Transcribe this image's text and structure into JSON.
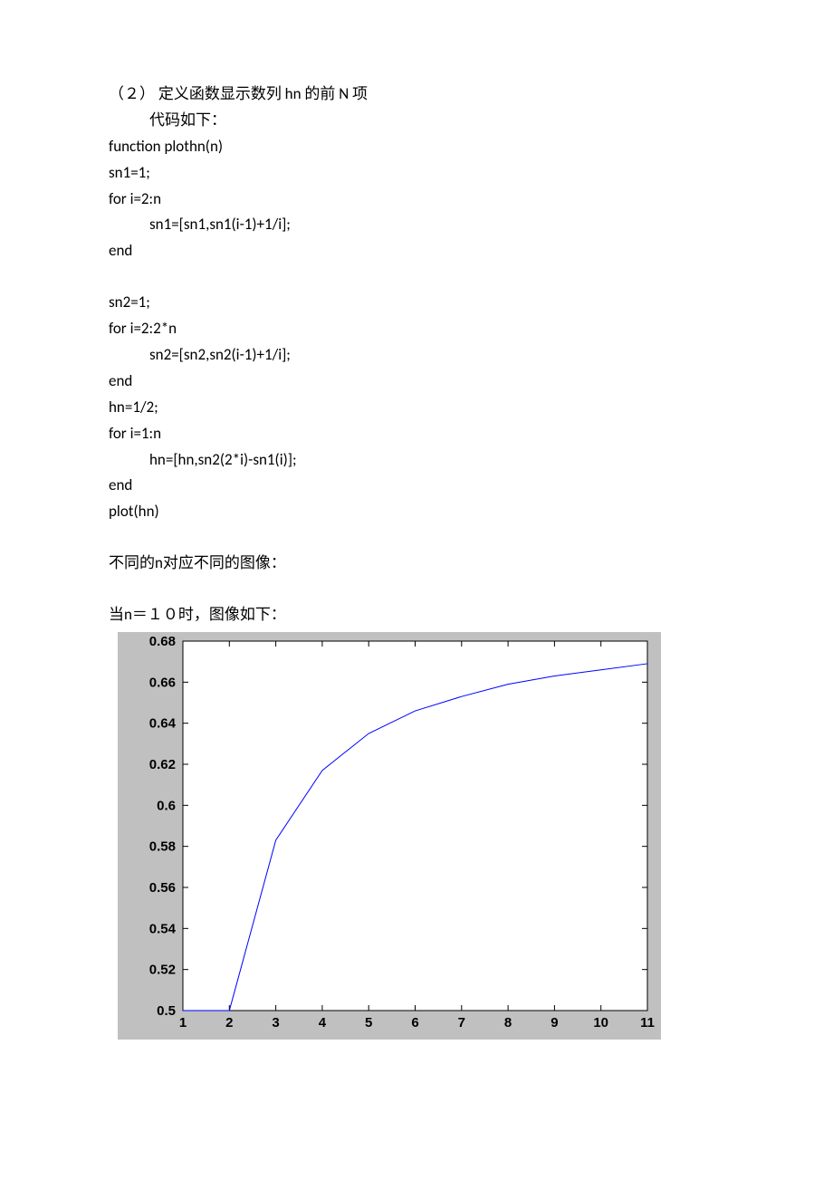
{
  "text": {
    "heading": "（２） 定义函数显示数列 hn 的前 N 项",
    "subhead": "代码如下：",
    "c1": "function plothn(n)",
    "c2": "sn1=1;",
    "c3": "for i=2:n",
    "c4": "sn1=[sn1,sn1(i-1)+1/i];",
    "c5": "end",
    "c6": "sn2=1;",
    "c7": "for i=2:2*n",
    "c8": "sn2=[sn2,sn2(i-1)+1/i];",
    "c9": "end",
    "c10": "hn=1/2;",
    "c11": "for i=1:n",
    "c12": "hn=[hn,sn2(2*i)-sn1(i)];",
    "c13": "end",
    "c14": "plot(hn)",
    "note1": "不同的n对应不同的图像：",
    "note2": "当n＝１０时，图像如下："
  },
  "chart_data": {
    "type": "line",
    "x": [
      1,
      2,
      3,
      4,
      5,
      6,
      7,
      8,
      9,
      10,
      11
    ],
    "values": [
      0.5,
      0.5,
      0.583,
      0.617,
      0.635,
      0.646,
      0.653,
      0.659,
      0.663,
      0.666,
      0.669
    ],
    "x_ticks": [
      1,
      2,
      3,
      4,
      5,
      6,
      7,
      8,
      9,
      10,
      11
    ],
    "y_ticks": [
      0.5,
      0.52,
      0.54,
      0.56,
      0.58,
      0.6,
      0.62,
      0.64,
      0.66,
      0.68
    ],
    "xlim": [
      1,
      11
    ],
    "ylim": [
      0.5,
      0.68
    ]
  }
}
